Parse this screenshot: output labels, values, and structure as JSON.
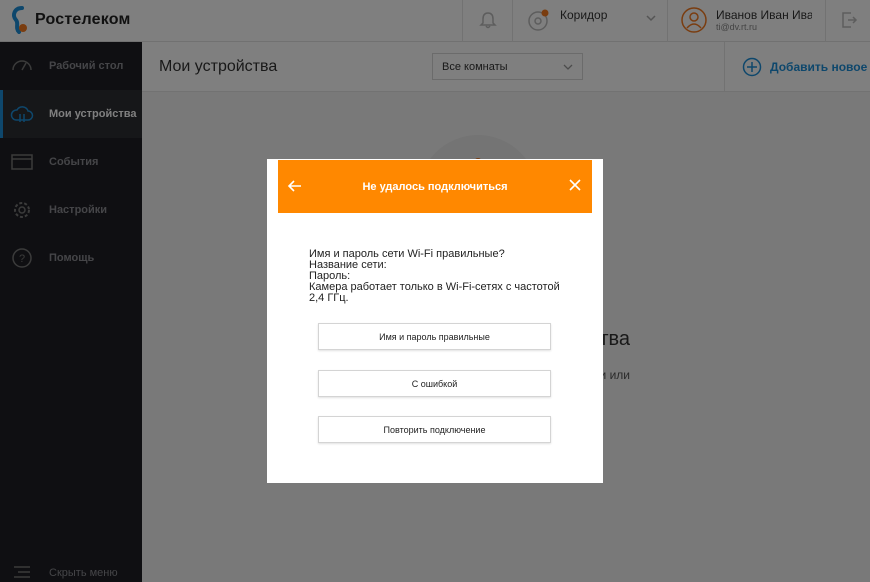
{
  "brand": {
    "name": "Ростелеком",
    "accent": "#ff8800",
    "link_color": "#1d8fd8"
  },
  "topbar": {
    "room_label": "Коридор",
    "user_name": "Иванов Иван Иванович",
    "user_email": "ti@dv.rt.ru",
    "icons": [
      "bell-icon",
      "room-camera-icon",
      "chevron-down-icon",
      "avatar-icon",
      "logout-icon"
    ]
  },
  "sidebar": {
    "items": [
      {
        "label": "Рабочий стол",
        "icon": "dashboard-icon",
        "active": false
      },
      {
        "label": "Мои устройства",
        "icon": "cloud-icon",
        "active": true
      },
      {
        "label": "События",
        "icon": "events-icon",
        "active": false
      },
      {
        "label": "Настройки",
        "icon": "gear-icon",
        "active": false
      },
      {
        "label": "Помощь",
        "icon": "help-icon",
        "active": false
      }
    ],
    "collapse_label": "Скрыть меню"
  },
  "main": {
    "title": "Мои устройства",
    "rooms_select": {
      "value": "Все комнаты"
    },
    "add_new_label": "Добавить новое",
    "bg_heading_fragment": "тва",
    "bg_sub_fragment": "и или"
  },
  "modal": {
    "title": "Не удалось подключиться",
    "body_lines": [
      "Имя и пароль сети Wi-Fi правильные?",
      "Название сети:",
      "Пароль:",
      "Камера работает только в Wi-Fi-сетях с частотой 2,4 ГГц."
    ],
    "buttons": {
      "correct": "Имя и пароль правильные",
      "error": "С ошибкой",
      "retry": "Повторить подключение"
    }
  }
}
